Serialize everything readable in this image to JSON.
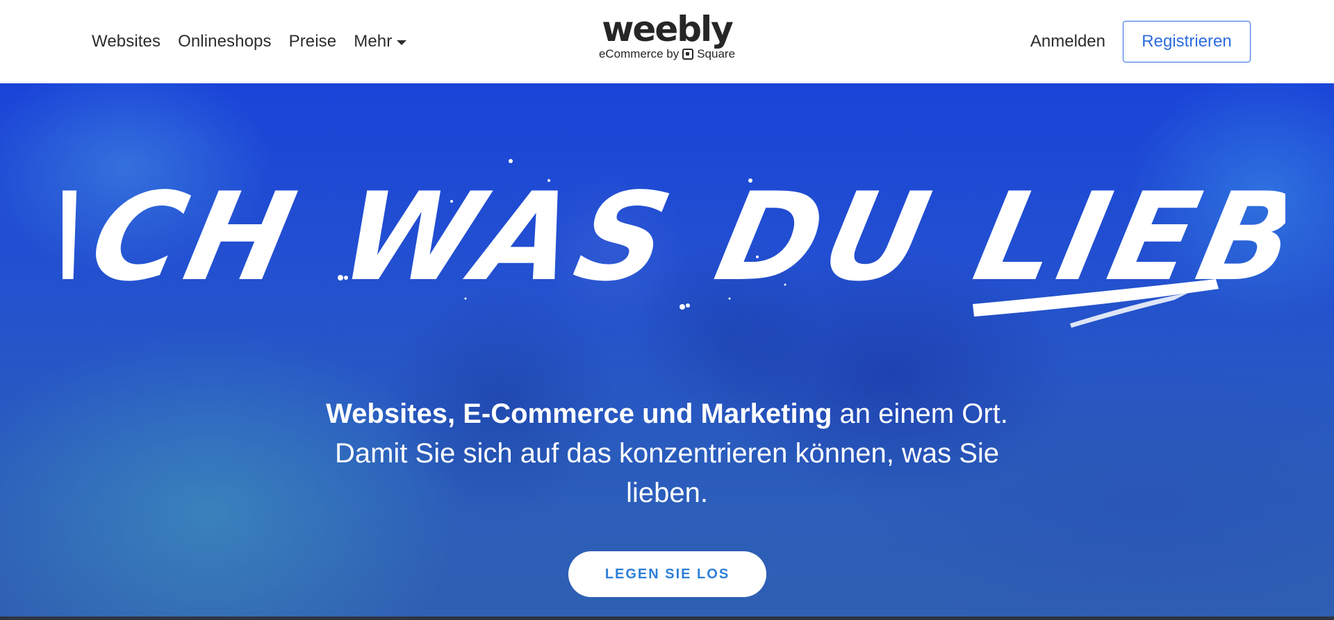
{
  "header": {
    "nav": [
      {
        "label": "Websites"
      },
      {
        "label": "Onlineshops"
      },
      {
        "label": "Preise"
      },
      {
        "label": "Mehr"
      }
    ],
    "logo": {
      "word": "weebly",
      "sub_prefix": "eCommerce by",
      "sub_brand": "Square"
    },
    "login_label": "Anmelden",
    "register_label": "Registrieren"
  },
  "hero": {
    "headline": "MACH WAS DU LIEBST",
    "subtitle_bold": "Websites, E-Commerce und Marketing",
    "subtitle_rest": " an einem Ort. Damit Sie sich auf das konzentrieren können, was Sie lieben.",
    "cta_label": "LEGEN SIE LOS"
  },
  "colors": {
    "accent": "#2d6cdf",
    "hero_blue": "#1a44d8",
    "cta_text": "#2d7fd8"
  },
  "icons": {
    "dropdown": "caret-down-icon",
    "square_logo": "square-logo-icon"
  }
}
